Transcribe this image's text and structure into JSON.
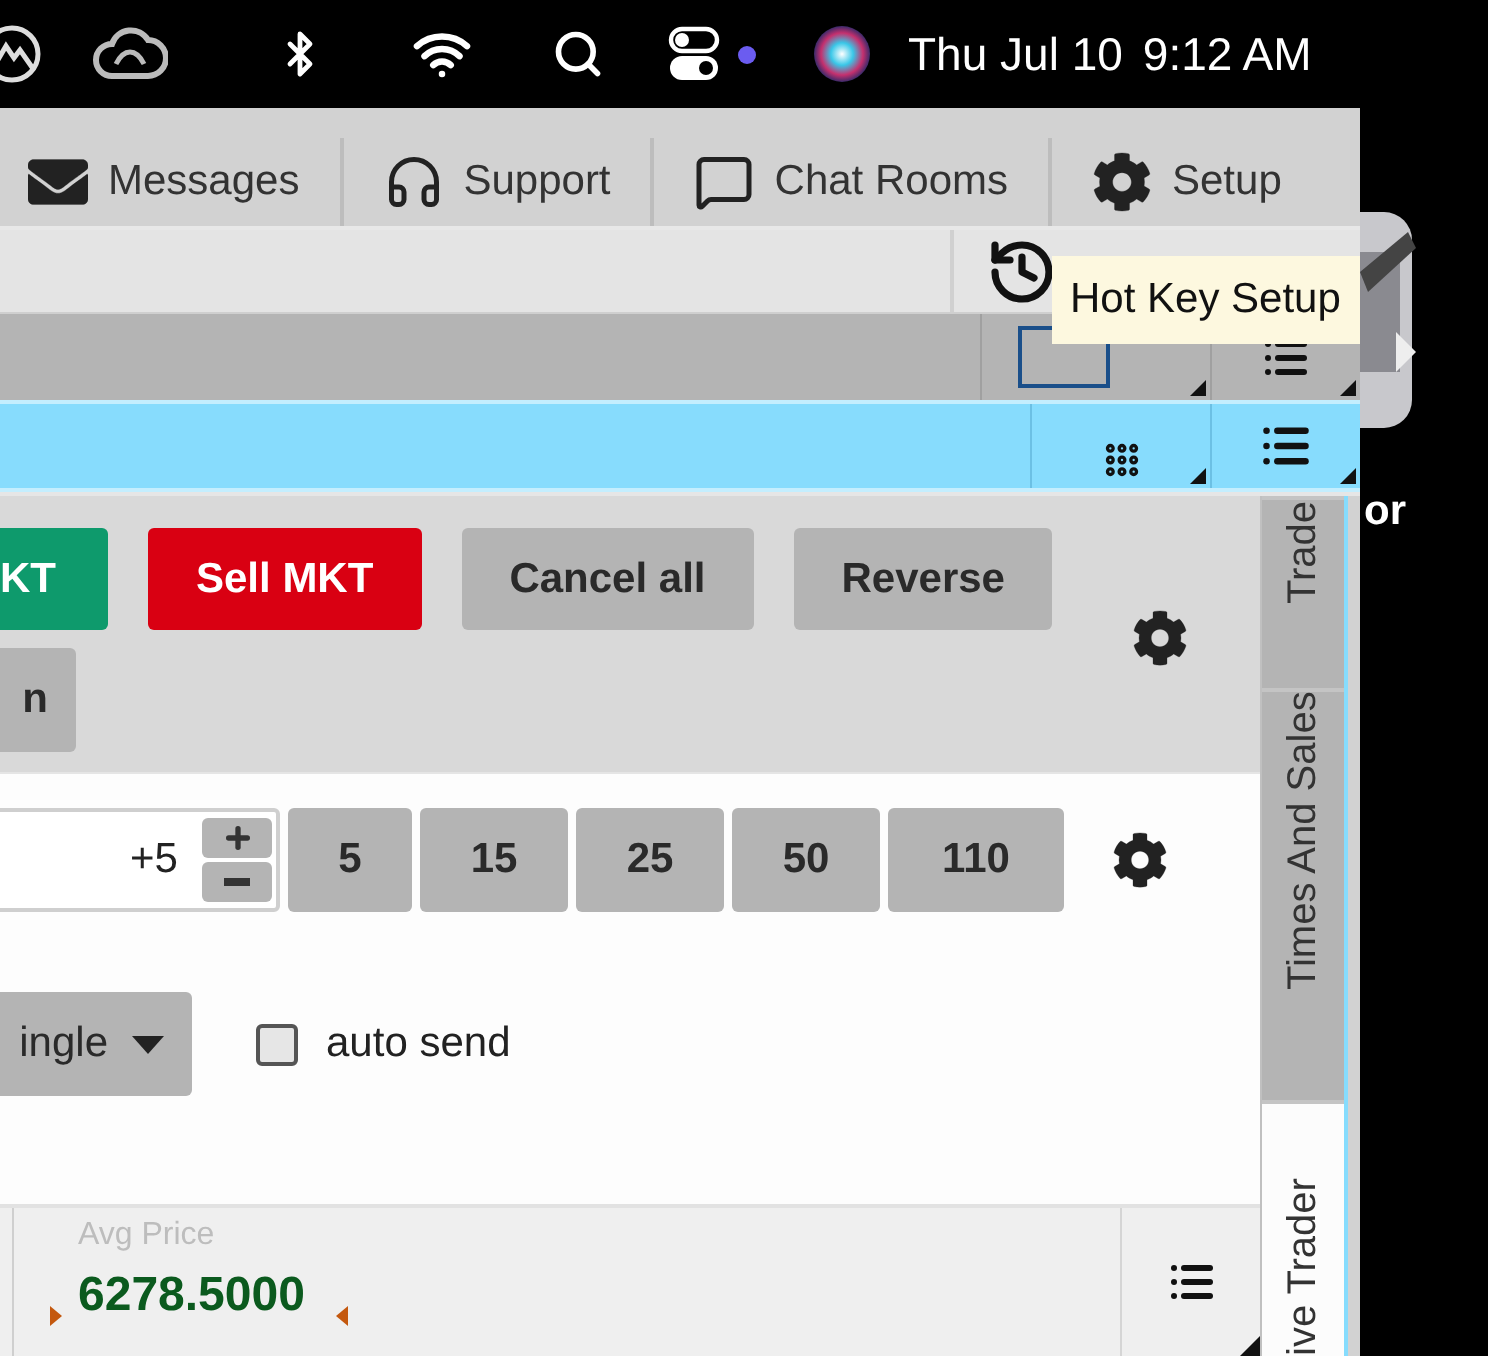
{
  "menu_bar": {
    "date": "Thu Jul 10",
    "time": "9:12 AM"
  },
  "nav": [
    {
      "label": "Messages"
    },
    {
      "label": "Support"
    },
    {
      "label": "Chat Rooms"
    },
    {
      "label": "Setup"
    }
  ],
  "tooltip": "Hot Key Setup",
  "order_buttons": [
    {
      "label": "KT",
      "kind": "buy"
    },
    {
      "label": "Sell MKT",
      "kind": "sell"
    },
    {
      "label": "Cancel all",
      "kind": "neutral"
    },
    {
      "label": "Reverse",
      "kind": "neutral"
    }
  ],
  "second_row_button": "n",
  "quantity": {
    "value": "+5"
  },
  "quantity_presets": [
    "5",
    "15",
    "25",
    "50",
    "110"
  ],
  "order_type": {
    "value": "ingle"
  },
  "auto_send": {
    "label": "auto send",
    "checked": false
  },
  "position": {
    "label": "Avg Price",
    "value": "6278.5000"
  },
  "side_tabs": [
    {
      "label": "Trade",
      "selected": false
    },
    {
      "label": "Times And Sales",
      "selected": false
    },
    {
      "label": "ive Trader",
      "selected": true
    }
  ],
  "dock": {
    "label": "or"
  }
}
